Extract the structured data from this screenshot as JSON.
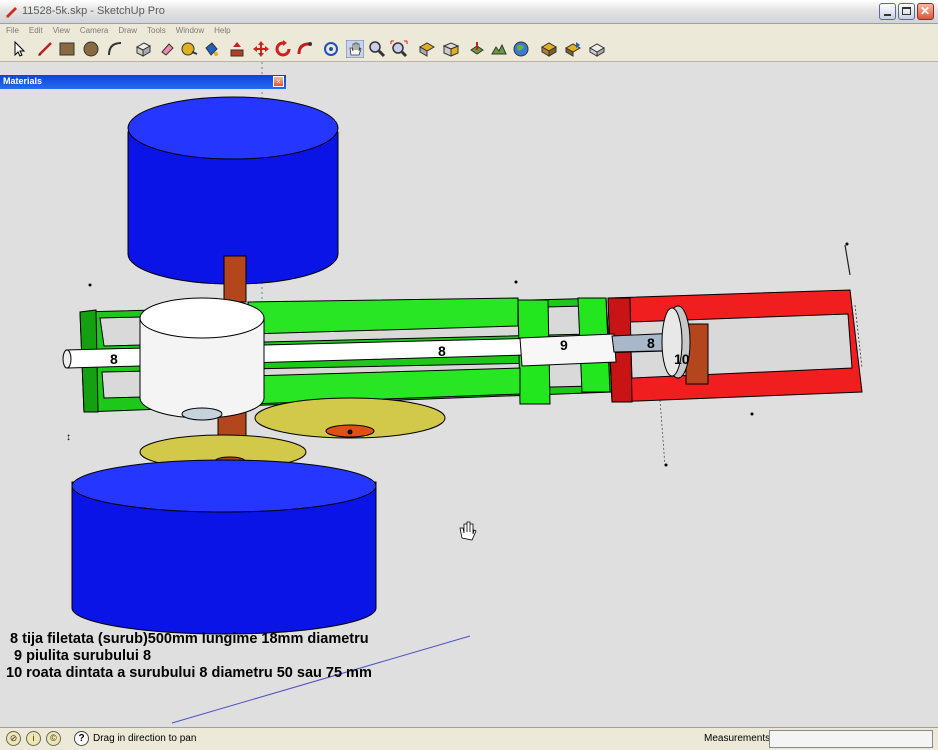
{
  "window": {
    "title": "11528-5k.skp - SketchUp Pro"
  },
  "menu": [
    "File",
    "Edit",
    "View",
    "Camera",
    "Draw",
    "Tools",
    "Window",
    "Help"
  ],
  "toolbar": {
    "tools": [
      "select-icon",
      "line-icon",
      "rectangle-icon",
      "circle-icon",
      "arc-icon",
      "make-component-icon",
      "eraser-icon",
      "tape-measure-icon",
      "paint-bucket-icon",
      "push-pull-icon",
      "move-icon",
      "rotate-icon",
      "follow-me-icon",
      "orbit-icon",
      "pan-icon",
      "zoom-icon",
      "zoom-extents-icon",
      "top-view-icon",
      "iso-view-icon",
      "add-location-icon",
      "toggle-terrain-icon",
      "google-earth-icon",
      "get-models-icon",
      "share-model-icon",
      "share-component-icon"
    ]
  },
  "materials_panel": {
    "title": "Materials",
    "close": "×"
  },
  "labels": {
    "l1": "8",
    "l2": "8",
    "l3": "9",
    "l4": "8",
    "l5": "10"
  },
  "notes": [
    " 8 tija filetata (surub)500mm lungime 18mm diametru",
    "  9 piulita surubului 8",
    "10 roata dintata a surubului 8 diametru 50 sau 75 mm"
  ],
  "status": {
    "text": "Drag in direction to pan",
    "measurements_label": "Measurements",
    "measurements_value": ""
  },
  "colors": {
    "blue": "#0a14e6",
    "green": "#22e61e",
    "red": "#f01e1e",
    "olive": "#d2c84a",
    "rust": "#b4461e"
  }
}
